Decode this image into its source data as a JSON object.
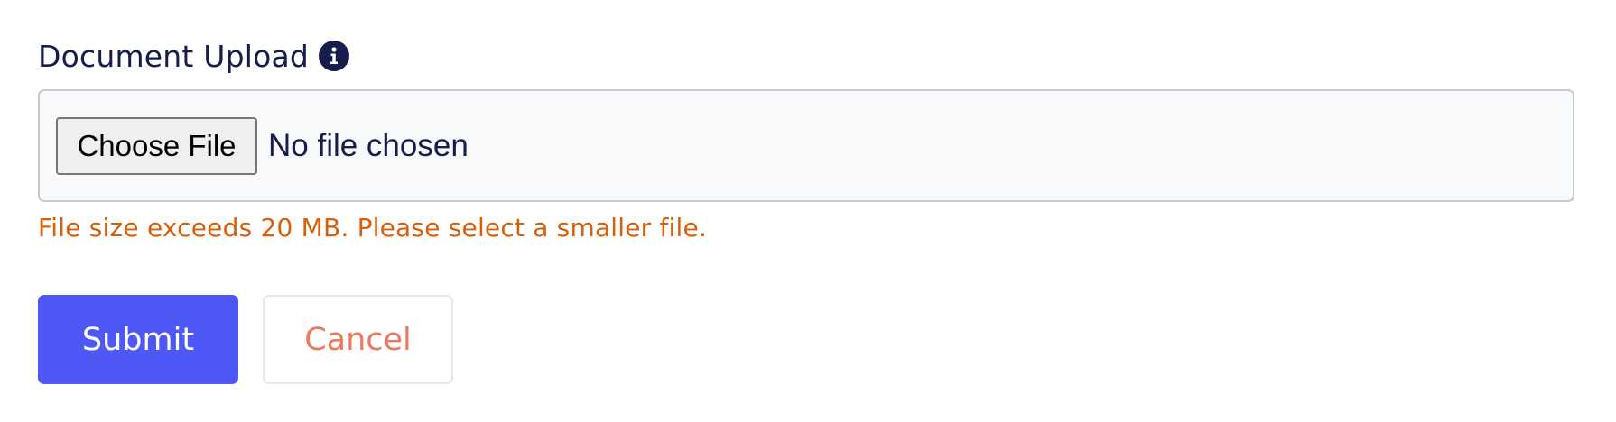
{
  "form": {
    "label": "Document Upload",
    "info_icon": "info-circle-icon",
    "file_input": {
      "button_label": "Choose File",
      "status": "No file chosen"
    },
    "error_message": "File size exceeds 20 MB. Please select a smaller file.",
    "submit_label": "Submit",
    "cancel_label": "Cancel"
  },
  "colors": {
    "label": "#161d4d",
    "error": "#d9600b",
    "submit_bg": "#4e58f7",
    "cancel_text": "#ec7a5d",
    "input_bg": "#f8f9fb",
    "input_border": "#c8cad3"
  }
}
